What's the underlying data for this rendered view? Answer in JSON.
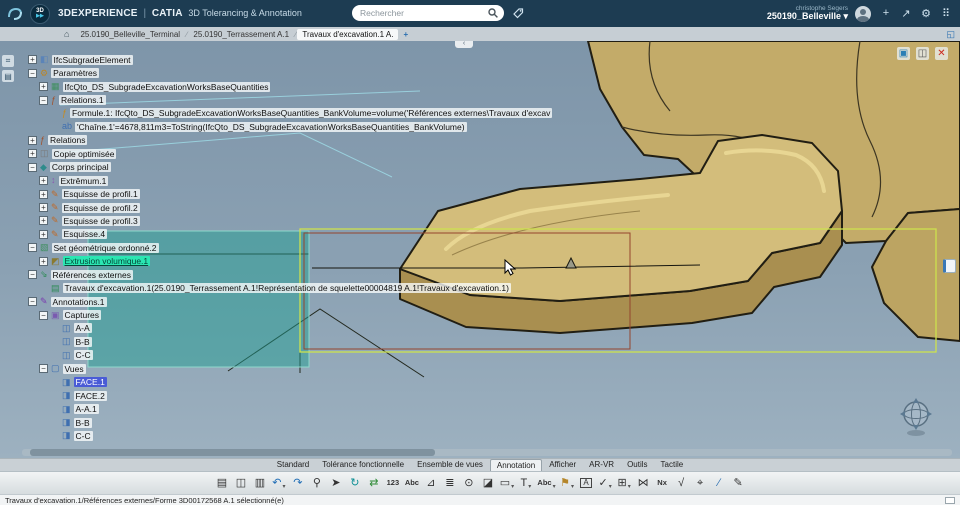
{
  "topbar": {
    "brand": "3DEXPERIENCE",
    "divider": "|",
    "app_brand": "CATIA",
    "app_name": "3D Tolerancing & Annotation",
    "badge_text": "3D",
    "badge_play": "▶▶",
    "search": {
      "placeholder": "Rechercher"
    },
    "user_name": "christophe Segers",
    "tenant": "250190_Belleville ▾",
    "icons": [
      {
        "name": "add-icon",
        "glyph": "+"
      },
      {
        "name": "share-icon",
        "glyph": "↗"
      },
      {
        "name": "settings-icon",
        "glyph": "⚙"
      },
      {
        "name": "apps-grid-icon",
        "glyph": "⠿"
      }
    ]
  },
  "tabbar": {
    "home_glyph": "⌂",
    "tabs": [
      {
        "label": "25.0190_Belleville_Terminal",
        "active": false
      },
      {
        "label": "25.0190_Terrassement A.1",
        "active": false
      },
      {
        "label": "Travaux d'excavation.1 A.",
        "active": true
      }
    ],
    "add_label": "+",
    "maximize_glyph": "◱"
  },
  "viewport": {
    "collapse_handle": "‹",
    "top_icons": [
      {
        "name": "capture-screen-icon",
        "glyph": "▣",
        "color": "#2a7fb5"
      },
      {
        "name": "panel-icon",
        "glyph": "◫",
        "color": "#555555"
      },
      {
        "name": "close-icon",
        "glyph": "✕",
        "color": "#cc2a1e"
      }
    ],
    "left_buttons": [
      {
        "name": "tree-toggle-icon",
        "glyph": "⌗"
      },
      {
        "name": "panel-toggle-icon",
        "glyph": "▤"
      }
    ],
    "colors": {
      "background_top": "#7e95a9",
      "background_bottom": "#9db1c0",
      "model_tan": "#c3ab69",
      "model_top_face": "#d3bd7b",
      "selection_teal": "rgba(32,158,146,0.48)",
      "bounds_yellow": "#cde24e",
      "bounds_red": "#94452e",
      "highlight_green": "#2ae6b2",
      "selected_blue": "#4a5bd6"
    }
  },
  "tree": {
    "items": [
      {
        "label": "IfcSubgradeElement",
        "depth": 0,
        "exp": "+",
        "icon": "element-icon"
      },
      {
        "label": "Paramètres",
        "depth": 0,
        "exp": "-",
        "icon": "params-icon"
      },
      {
        "label": "IfcQto_DS_SubgradeExcavationWorksBaseQuantities",
        "depth": 1,
        "exp": "+",
        "icon": "quantity-icon"
      },
      {
        "label": "Relations.1",
        "depth": 1,
        "exp": "-",
        "icon": "relations-icon"
      },
      {
        "label": "Formule.1: IfcQto_DS_SubgradeExcavationWorksBaseQuantities_BankVolume=volume('Références externes\\Travaux d'excav",
        "depth": 2,
        "exp": null,
        "icon": "formula-icon"
      },
      {
        "label": "'Chaîne.1'=4678,811m3=ToString(IfcQto_DS_SubgradeExcavationWorksBaseQuantities_BankVolume)",
        "depth": 2,
        "exp": null,
        "icon": "string-icon"
      },
      {
        "label": "Relations",
        "depth": 0,
        "exp": "+",
        "icon": "relations-icon"
      },
      {
        "label": "Copie optimisée",
        "depth": 0,
        "exp": "+",
        "icon": "copy-node-icon"
      },
      {
        "label": "Corps principal",
        "depth": 0,
        "exp": "-",
        "icon": "body-icon"
      },
      {
        "label": "Extrêmum.1",
        "depth": 1,
        "exp": "+",
        "icon": "extremum-icon"
      },
      {
        "label": "Esquisse de profil.1",
        "depth": 1,
        "exp": "+",
        "icon": "sketch-icon"
      },
      {
        "label": "Esquisse de profil.2",
        "depth": 1,
        "exp": "+",
        "icon": "sketch-icon"
      },
      {
        "label": "Esquisse de profil.3",
        "depth": 1,
        "exp": "+",
        "icon": "sketch-icon"
      },
      {
        "label": "Esquisse.4",
        "depth": 1,
        "exp": "+",
        "icon": "sketch-icon"
      },
      {
        "label": "Set géométrique ordonné.2",
        "depth": 0,
        "exp": "-",
        "icon": "geoset-icon"
      },
      {
        "label": "Extrusion volumique.1",
        "depth": 1,
        "exp": "+",
        "icon": "pad-icon",
        "state": "highlight"
      },
      {
        "label": "Références externes",
        "depth": 0,
        "exp": "-",
        "icon": "extref-icon"
      },
      {
        "label": "Travaux d'excavation.1(25.0190_Terrassement A.1!Représentation de squelette00004819 A.1!Travaux d'excavation.1)",
        "depth": 1,
        "exp": null,
        "icon": "link-icon"
      },
      {
        "label": "Annotations.1",
        "depth": 0,
        "exp": "-",
        "icon": "annotations-icon"
      },
      {
        "label": "Captures",
        "depth": 1,
        "exp": "-",
        "icon": "captures-icon"
      },
      {
        "label": "A-A",
        "depth": 2,
        "exp": null,
        "icon": "capture-icon"
      },
      {
        "label": "B-B",
        "depth": 2,
        "exp": null,
        "icon": "capture-icon"
      },
      {
        "label": "C-C",
        "depth": 2,
        "exp": null,
        "icon": "capture-icon"
      },
      {
        "label": "Vues",
        "depth": 1,
        "exp": "-",
        "icon": "views-icon"
      },
      {
        "label": "FACE.1",
        "depth": 2,
        "exp": null,
        "icon": "view-icon",
        "state": "selected"
      },
      {
        "label": "FACE.2",
        "depth": 2,
        "exp": null,
        "icon": "view-icon"
      },
      {
        "label": "A-A.1",
        "depth": 2,
        "exp": null,
        "icon": "view-icon"
      },
      {
        "label": "B-B",
        "depth": 2,
        "exp": null,
        "icon": "view-icon"
      },
      {
        "label": "C-C",
        "depth": 2,
        "exp": null,
        "icon": "view-icon"
      }
    ]
  },
  "toolbar": {
    "tabs": [
      {
        "label": "Standard",
        "active": false
      },
      {
        "label": "Tolérance fonctionnelle",
        "active": false
      },
      {
        "label": "Ensemble de vues",
        "active": false
      },
      {
        "label": "Annotation",
        "active": true
      },
      {
        "label": "Afficher",
        "active": false
      },
      {
        "label": "AR-VR",
        "active": false
      },
      {
        "label": "Outils",
        "active": false
      },
      {
        "label": "Tactile",
        "active": false
      }
    ],
    "icons": [
      {
        "name": "paste-icon",
        "glyph": "▤"
      },
      {
        "name": "copy-icon",
        "glyph": "◫"
      },
      {
        "name": "paste-special-icon",
        "glyph": "▥"
      },
      {
        "name": "undo-icon",
        "glyph": "↶",
        "color": "#1f6db5",
        "dropdown": true
      },
      {
        "name": "redo-icon",
        "glyph": "↷",
        "color": "#1f6db5"
      },
      {
        "name": "zoom-icon",
        "glyph": "⚲"
      },
      {
        "name": "pointer-icon",
        "glyph": "➤"
      },
      {
        "name": "update-icon",
        "glyph": "↻",
        "color": "#0d8f94"
      },
      {
        "name": "swap-visible-icon",
        "glyph": "⇄",
        "color": "#2d8a35"
      },
      {
        "name": "measure-123-icon",
        "glyph": "123"
      },
      {
        "name": "measure-abc-icon",
        "glyph": "Abc"
      },
      {
        "name": "measure-angle-icon",
        "glyph": "⊿"
      },
      {
        "name": "layers-icon",
        "glyph": "≣"
      },
      {
        "name": "hide-show-icon",
        "glyph": "⊙"
      },
      {
        "name": "section-view-icon",
        "glyph": "◪"
      },
      {
        "name": "view-selector-icon",
        "glyph": "▭",
        "dropdown": true
      },
      {
        "name": "text-tool-icon",
        "glyph": "T",
        "dropdown": true
      },
      {
        "name": "text-note-icon",
        "glyph": "Abc",
        "dropdown": true
      },
      {
        "name": "flag-note-icon",
        "glyph": "⚑",
        "color": "#b5862a",
        "dropdown": true
      },
      {
        "name": "datum-frame-icon",
        "glyph": "A",
        "boxed": true
      },
      {
        "name": "tolerance-check-icon",
        "glyph": "✓",
        "dropdown": true
      },
      {
        "name": "table-icon",
        "glyph": "⊞",
        "dropdown": true
      },
      {
        "name": "weld-symbol-icon",
        "glyph": "⋈"
      },
      {
        "name": "nx-icon",
        "glyph": "Nx"
      },
      {
        "name": "roughness-icon",
        "glyph": "√"
      },
      {
        "name": "datum-target-icon",
        "glyph": "⌖"
      },
      {
        "name": "annotation-plane-icon",
        "glyph": "∕",
        "color": "#2d6fb0"
      },
      {
        "name": "paint-icon",
        "glyph": "✎"
      }
    ]
  },
  "statusbar": {
    "message": "Travaux d'excavation.1/Références externes/Forme 3D00172568 A.1 sélectionné(e)"
  }
}
